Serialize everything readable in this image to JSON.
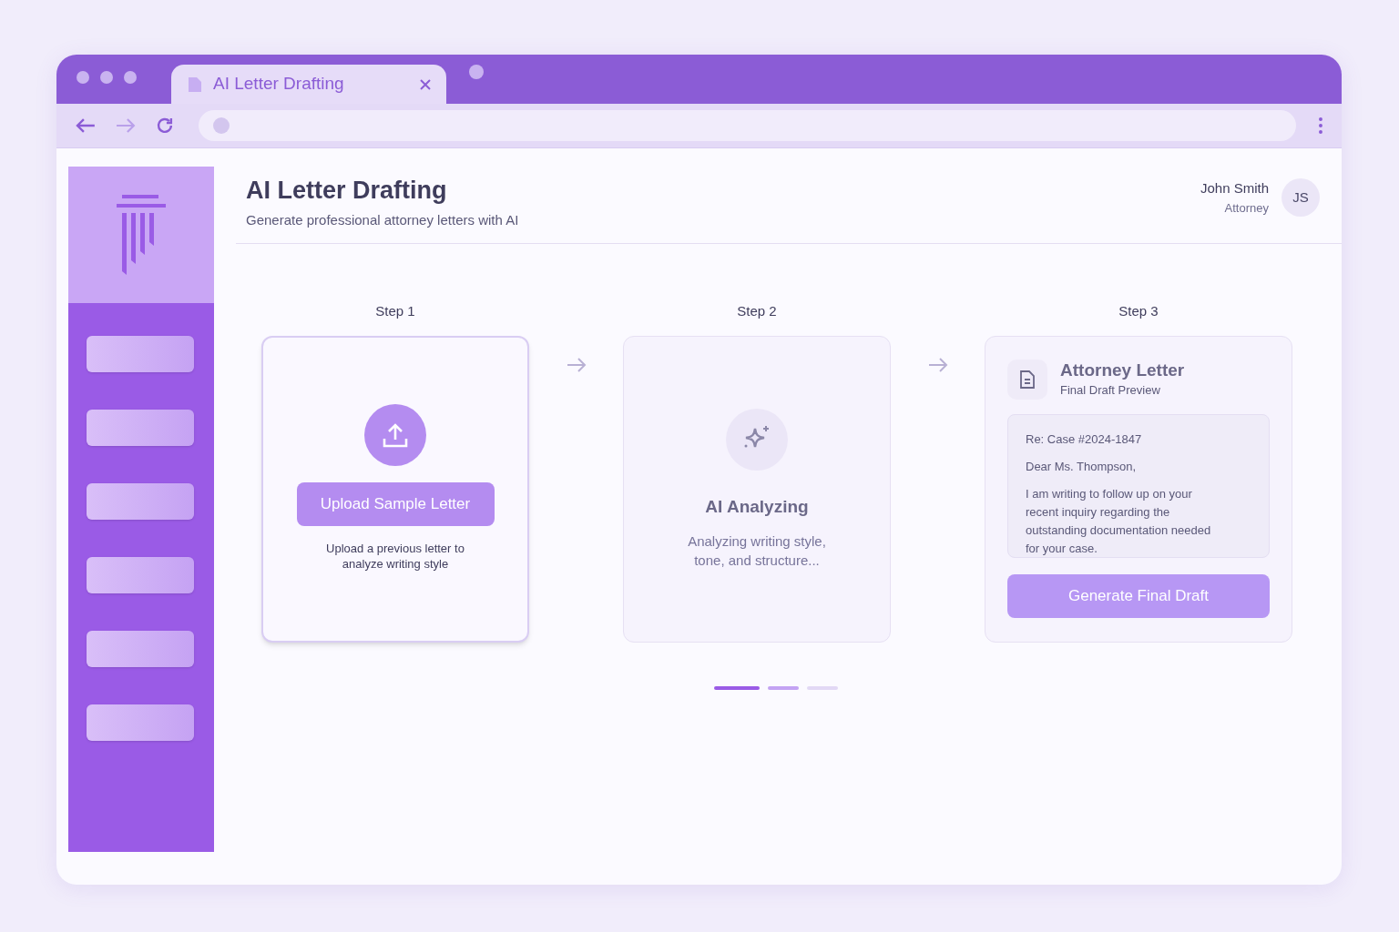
{
  "browser": {
    "tab": {
      "title": "AI Letter Drafting",
      "selected": true
    }
  },
  "sidebar": {
    "items": [
      {
        "kind": "placeholder"
      },
      {
        "kind": "placeholder"
      },
      {
        "kind": "placeholder"
      },
      {
        "kind": "placeholder"
      },
      {
        "kind": "placeholder"
      },
      {
        "kind": "placeholder"
      }
    ]
  },
  "header": {
    "title": "AI Letter Drafting",
    "subtitle": "Generate professional attorney letters with AI"
  },
  "user": {
    "name": "John Smith",
    "role": "Attorney",
    "initials": "JS"
  },
  "steps": [
    {
      "kind": "upload",
      "label": "Step 1",
      "selected": true,
      "button": "Upload Sample Letter",
      "caption": "Upload a previous letter to analyze writing style"
    },
    {
      "kind": "analyze",
      "label": "Step 2",
      "selected": false,
      "title": "AI Analyzing",
      "caption": "Analyzing writing style, tone, and structure..."
    },
    {
      "kind": "preview",
      "label": "Step 3",
      "selected": false,
      "title": "Attorney Letter",
      "subtitle": "Final Draft Preview",
      "letter": [
        "Re: Case #2024-1847",
        "Dear Ms. Thompson,",
        "I am writing to follow up on your recent inquiry regarding the outstanding documentation needed for your case."
      ],
      "button": "Generate Final Draft"
    }
  ],
  "progress": [
    {
      "selected": true,
      "color": "#9a5be6"
    },
    {
      "selected": false,
      "color": "#c3a3f3"
    },
    {
      "selected": false,
      "color": "#e2d8f5"
    }
  ]
}
